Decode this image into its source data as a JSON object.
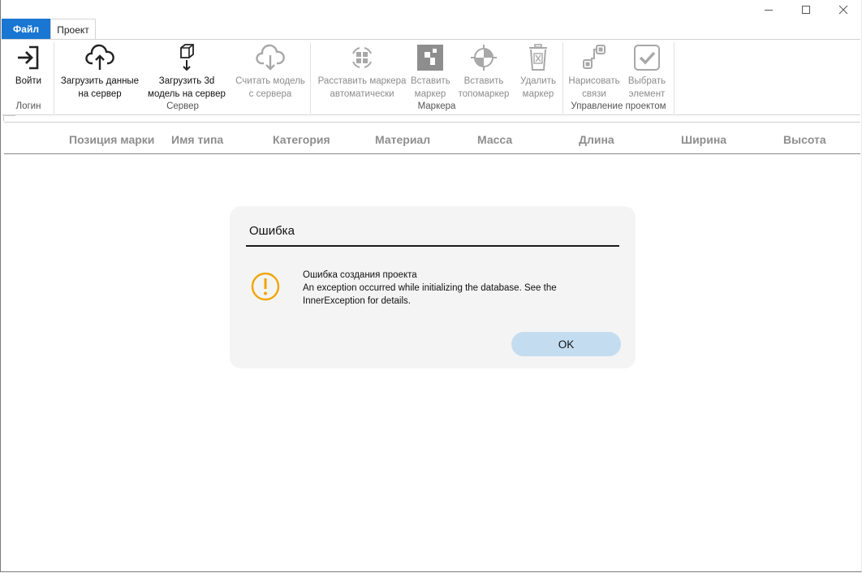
{
  "window": {
    "controls": [
      "minimize",
      "maximize",
      "close"
    ]
  },
  "tabs": {
    "file_label": "Файл",
    "project_label": "Проект"
  },
  "ribbon": {
    "login_btn": {
      "line1": "Войти",
      "icon": "sign-in-icon"
    },
    "upload_data_btn": {
      "line1": "Загрузить данные",
      "line2": "на сервер",
      "icon": "cloud-upload-icon"
    },
    "upload_model_btn": {
      "line1": "Загрузить 3d",
      "line2": "модель на сервер",
      "icon": "cube-download-icon"
    },
    "read_model_btn": {
      "line1": "Считать модель",
      "line2": "с сервера",
      "icon": "cloud-download-icon"
    },
    "auto_markers_btn": {
      "line1": "Расставить маркера",
      "line2": "автоматически",
      "icon": "auto-markers-icon"
    },
    "insert_marker_btn": {
      "line1": "Вставить",
      "line2": "маркер",
      "icon": "marker-icon"
    },
    "insert_topomarker_btn": {
      "line1": "Вставить",
      "line2": "топомаркер",
      "icon": "topomarker-icon"
    },
    "delete_marker_btn": {
      "line1": "Удалить",
      "line2": "маркер",
      "icon": "trash-icon"
    },
    "draw_links_btn": {
      "line1": "Нарисовать",
      "line2": "связи",
      "icon": "links-icon"
    },
    "select_element_btn": {
      "line1": "Выбрать",
      "line2": "элемент",
      "icon": "checkmark-icon"
    },
    "groups": {
      "login": "Логин",
      "server": "Сервер",
      "markers": "Маркера",
      "project": "Управление проектом"
    }
  },
  "table": {
    "columns": [
      "Позиция марки",
      "Имя типа",
      "Категория",
      "Материал",
      "Масса",
      "Длина",
      "Ширина",
      "Высота"
    ]
  },
  "dialog": {
    "title": "Ошибка",
    "icon": "warning-icon",
    "message_line1": "Ошибка создания проекта",
    "message_line2": "An exception occurred while initializing the database. See the InnerException for details.",
    "ok_label": "OK",
    "accent": "#f0a500"
  }
}
